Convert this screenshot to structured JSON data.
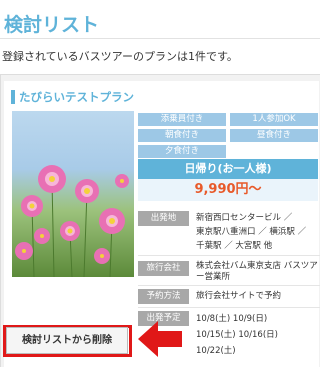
{
  "page": {
    "title": "検討リスト",
    "intro": "登録されているバスツアーのプランは1件です。"
  },
  "plan": {
    "title": "たびらいテストプラン",
    "badges": [
      "添乗員付き",
      "1人参加OK",
      "朝食付き",
      "昼食付き",
      "夕食付き"
    ],
    "duration_label": "日帰り(お一人様)",
    "price": "9,990円〜",
    "details": {
      "departure_label": "出発地",
      "departure_lines": [
        "新宿西口センタービル ／",
        "東京駅八重洲口 ／ 横浜駅 ／",
        "千葉駅 ／ 大宮駅 他"
      ],
      "agency_label": "旅行会社",
      "agency_lines": [
        "株式会社バム東京支店 バスツア",
        "ー営業所"
      ],
      "booking_label": "予約方法",
      "booking_value": "旅行会社サイトで予約",
      "dates_label": "出発予定",
      "date_lines": [
        "10/8(土)  10/9(日)",
        "10/15(土)  10/16(日)",
        "10/22(土)"
      ]
    }
  },
  "actions": {
    "remove_label": "検討リストから削除"
  },
  "colors": {
    "accent": "#5fb3d9",
    "badge": "#9dc8e6",
    "price": "#e85a2a",
    "highlight": "#e01818"
  },
  "icons": {
    "arrow": "arrow-left-icon"
  }
}
